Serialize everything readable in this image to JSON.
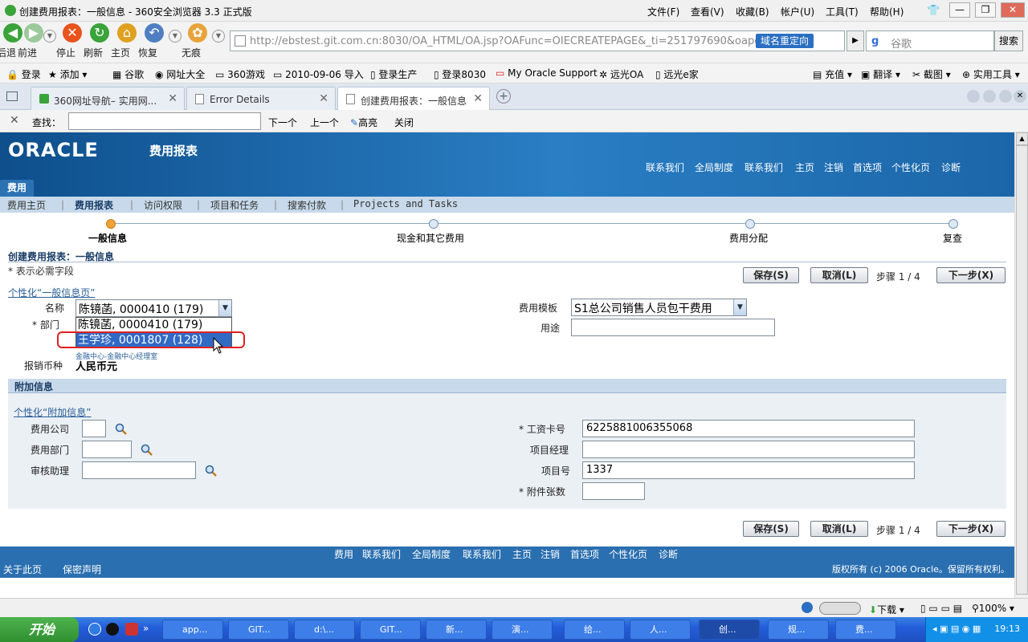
{
  "browser": {
    "window_title": "创建费用报表：一般信息 - 360安全浏览器 3.3 正式版",
    "menu": [
      "文件(F)",
      "查看(V)",
      "收藏(B)",
      "帐户(U)",
      "工具(T)",
      "帮助(H)"
    ],
    "nav_buttons": [
      {
        "label": "后退",
        "icon": "back-arrow-icon",
        "color": "#3aa33a"
      },
      {
        "label": "前进",
        "icon": "forward-arrow-icon",
        "color": "#9bc99b"
      },
      {
        "label": "停止",
        "icon": "stop-icon",
        "color": "#e8541d"
      },
      {
        "label": "刷新",
        "icon": "refresh-icon",
        "color": "#3aa33a"
      },
      {
        "label": "主页",
        "icon": "home-icon",
        "color": "#e0a020"
      },
      {
        "label": "恢复",
        "icon": "undo-icon",
        "color": "#4f7fc2"
      },
      {
        "label": "无痕",
        "icon": "paw-icon",
        "color": "#e8a33a"
      }
    ],
    "address": "http://ebstest.git.com.cn:8030/OA_HTML/OA.jsp?OAFunc=OIECREATEPAGE&_ti=251797690&oapc:",
    "address_host": "ebstest.git.com.cn",
    "redirect_badge": "域名重定向",
    "search_placeholder": "谷歌",
    "search_button": "搜索",
    "bookmarks": [
      "登录",
      "添加",
      "谷歌",
      "网址大全",
      "360游戏",
      "2010-09-06 导入",
      "登录生产",
      "登录8030",
      "My Oracle Support",
      "远光OA",
      "远光e家"
    ],
    "bookmark_tools": [
      "充值",
      "翻译",
      "截图",
      "实用工具"
    ],
    "tabs": [
      {
        "label": "360网址导航– 实用网...",
        "active": false
      },
      {
        "label": "Error Details",
        "active": false
      },
      {
        "label": "创建费用报表：一般信息",
        "active": true
      }
    ],
    "find": {
      "label": "查找：",
      "value": "",
      "next": "下一个",
      "prev": "上一个",
      "highlight": "高亮",
      "close": "关闭"
    }
  },
  "oracle": {
    "logo": "ORACLE",
    "app_title": "费用报表",
    "global_links": [
      "联系我们",
      "全局制度",
      "联系我们",
      "主页",
      "注销",
      "首选项",
      "个性化页",
      "诊断"
    ],
    "main_tab": "费用",
    "subtabs": [
      "费用主页",
      "费用报表",
      "访问权限",
      "项目和任务",
      "搜索付款",
      "Projects and Tasks"
    ],
    "train": [
      {
        "label": "一般信息",
        "current": true
      },
      {
        "label": "现金和其它费用",
        "current": false
      },
      {
        "label": "费用分配",
        "current": false
      },
      {
        "label": "复查",
        "current": false
      }
    ]
  },
  "page": {
    "title": "创建费用报表：一般信息",
    "required_note": "* 表示必需字段",
    "save": "保存(S)",
    "cancel": "取消(L)",
    "step": "步骤 1 / 4",
    "next": "下一步(X)",
    "personalize_general": "个性化“一般信息页”",
    "name_label": "名称",
    "name_value": "陈镜菡, 0000410 (179)",
    "name_options": [
      "陈镜菡, 0000410 (179)",
      "王学珍, 0001807 (128)"
    ],
    "dept_label": "部门",
    "dept_value": "金融中心-金融中心经理室",
    "currency_label": "报销币种",
    "currency_value": "人民币元",
    "template_label": "费用模板",
    "template_value": "S1总公司销售人员包干费用",
    "purpose_label": "用途",
    "purpose_value": ""
  },
  "additional": {
    "header": "附加信息",
    "personalize": "个性化“附加信息”",
    "company_label": "费用公司",
    "company_value": "",
    "dept_label": "费用部门",
    "dept_value": "",
    "assistant_label": "审核助理",
    "assistant_value": "",
    "card_label": "工资卡号",
    "card_value": "6225881006355068",
    "pm_label": "项目经理",
    "pm_value": "",
    "project_label": "项目号",
    "project_value": "1337",
    "attach_label": "附件张数",
    "attach_value": ""
  },
  "footer": {
    "links": [
      "费用",
      "联系我们",
      "全局制度",
      "联系我们",
      "主页",
      "注销",
      "首选项",
      "个性化页",
      "诊断"
    ],
    "about": "关于此页",
    "privacy": "保密声明",
    "copyright": "版权所有 (c) 2006 Oracle。保留所有权利。"
  },
  "statusbar": {
    "download": "下载",
    "zoom": "100%"
  },
  "taskbar": {
    "start": "开始",
    "tasks": [
      "app...",
      "GIT...",
      "d:\\...",
      "GIT...",
      "新...",
      "演...",
      "给...",
      "人...",
      "创...",
      "规...",
      "费..."
    ],
    "clock": "19:13"
  },
  "colors": {
    "oracle_blue": "#2a6fb0",
    "highlight": "#316ac5",
    "annotation_red": "#e02020"
  }
}
